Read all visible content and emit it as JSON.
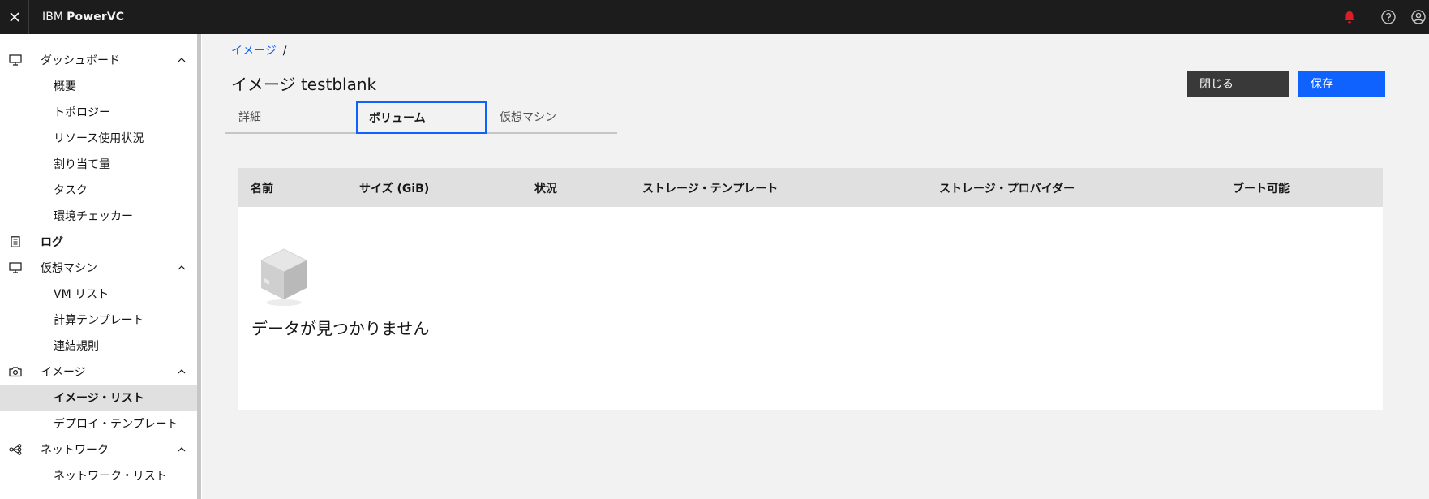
{
  "header": {
    "close_icon": "close-icon",
    "brand_prefix": "IBM",
    "brand_name": "PowerVC",
    "icons": [
      "notification-icon",
      "help-icon",
      "user-icon"
    ],
    "notification_color": "#da1e28"
  },
  "sidebar": {
    "items": [
      {
        "label": "ダッシュボード",
        "icon": "monitor-icon",
        "expanded": true
      },
      {
        "label": "概要"
      },
      {
        "label": "トポロジー"
      },
      {
        "label": "リソース使用状況"
      },
      {
        "label": "割り当て量"
      },
      {
        "label": "タスク"
      },
      {
        "label": "環境チェッカー"
      },
      {
        "label": "ログ",
        "icon": "log-icon"
      },
      {
        "label": "仮想マシン",
        "icon": "monitor-icon",
        "expanded": true
      },
      {
        "label": "VM リスト"
      },
      {
        "label": "計算テンプレート"
      },
      {
        "label": "連結規則"
      },
      {
        "label": "イメージ",
        "icon": "camera-icon",
        "expanded": true
      },
      {
        "label": "イメージ・リスト",
        "active": true
      },
      {
        "label": "デプロイ・テンプレート"
      },
      {
        "label": "ネットワーク",
        "icon": "network-icon",
        "expanded": true
      },
      {
        "label": "ネットワーク・リスト"
      }
    ]
  },
  "breadcrumb": {
    "link": "イメージ",
    "separator": "/"
  },
  "page": {
    "title": "イメージ testblank",
    "close_button": "閉じる",
    "save_button": "保存"
  },
  "tabs": [
    {
      "label": "詳細"
    },
    {
      "label": "ボリューム",
      "active": true
    },
    {
      "label": "仮想マシン"
    }
  ],
  "table": {
    "columns": [
      "名前",
      "サイズ (GiB)",
      "状況",
      "ストレージ・テンプレート",
      "ストレージ・プロバイダー",
      "ブート可能"
    ],
    "rows": [],
    "empty_text": "データが見つかりません"
  },
  "colors": {
    "accent": "#0f62fe",
    "header_bg": "#1c1c1c"
  }
}
